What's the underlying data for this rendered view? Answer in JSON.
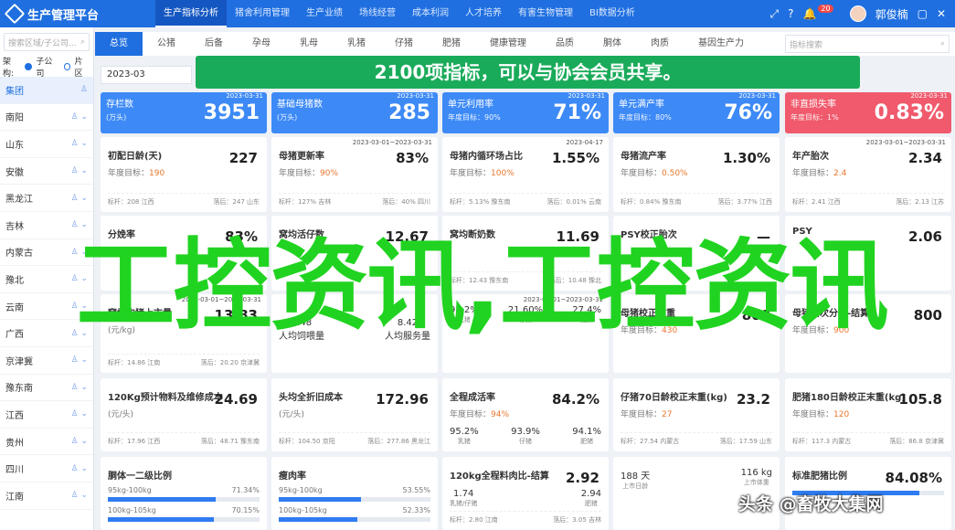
{
  "header": {
    "title": "生产管理平台",
    "nav": [
      "生产指标分析",
      "猪舍利用管理",
      "生产业绩",
      "场线经营",
      "成本利润",
      "人才培养",
      "有害生物管理",
      "BI数据分析"
    ],
    "badge": "20",
    "user": "郭俊楠"
  },
  "sidebar": {
    "search_placeholder": "搜索区域/子公司...",
    "filter_label": "架构:",
    "radio1": "子公司",
    "radio2": "片区",
    "items": [
      "集团",
      "南阳",
      "山东",
      "安徽",
      "黑龙江",
      "吉林",
      "内蒙古",
      "豫北",
      "云南",
      "广西",
      "京津冀",
      "豫东南",
      "江西",
      "贵州",
      "四川",
      "江南"
    ]
  },
  "tabs": {
    "items": [
      "总览",
      "公猪",
      "后备",
      "孕母",
      "乳母",
      "乳猪",
      "仔猪",
      "肥猪",
      "健康管理",
      "品质",
      "胴体",
      "肉质",
      "基因生产力"
    ],
    "search_placeholder": "指标搜索"
  },
  "date": "2023-03",
  "banner": "2100项指标，可以与协会会员共享。",
  "kpis": [
    {
      "label": "存栏数",
      "sub": "(万头)",
      "value": "3951",
      "date": "2023-03-31",
      "color": "#3d8af7"
    },
    {
      "label": "基础母猪数",
      "sub": "(万头)",
      "value": "285",
      "date": "2023-03-31",
      "color": "#3d8af7"
    },
    {
      "label": "单元利用率",
      "sub": "年度目标：90%",
      "value": "71%",
      "date": "2023-03-31",
      "color": "#3d8af7"
    },
    {
      "label": "单元满产率",
      "sub": "年度目标：80%",
      "value": "76%",
      "date": "2023-03-31",
      "color": "#3d8af7"
    },
    {
      "label": "非直损失率",
      "sub": "年度目标：1%",
      "value": "0.83%",
      "date": "2023-03-31",
      "color": "#f05a6c"
    }
  ],
  "row2": [
    {
      "title": "初配日龄(天)",
      "value": "227",
      "target": "190",
      "f1": "标杆：208 江西",
      "f2": "落后：247 山东",
      "date": ""
    },
    {
      "title": "母猪更新率",
      "value": "83%",
      "target": "90%",
      "f1": "标杆：127% 吉林",
      "f2": "落后：40% 四川",
      "date": "2023-03-01~2023-03-31"
    },
    {
      "title": "母猪内循环场占比",
      "value": "1.55%",
      "target": "100%",
      "f1": "标杆：5.13% 豫东南",
      "f2": "落后：0.01% 云南",
      "date": "2023-04-17"
    },
    {
      "title": "母猪流产率",
      "value": "1.30%",
      "target": "0.50%",
      "f1": "标杆：0.84% 豫东南",
      "f2": "落后：3.77% 江西",
      "date": ""
    },
    {
      "title": "年产胎次",
      "value": "2.34",
      "target": "2.4",
      "f1": "标杆：2.41 江西",
      "f2": "落后：2.13 江苏",
      "date": "2023-03-01~2023-03-31"
    }
  ],
  "row3": [
    {
      "title": "分娩率",
      "value": "83%"
    },
    {
      "title": "窝均活仔数",
      "value": "12.67"
    },
    {
      "title": "窝均断奶数",
      "value": "11.69",
      "f1": "标杆：12.43 豫东南",
      "f2": "落后：10.48 豫北"
    },
    {
      "title": "PSY校正胎次",
      "value": "—"
    },
    {
      "title": "PSY",
      "value": "2.06"
    }
  ],
  "row4": [
    {
      "title": "窝均肉猪上市量",
      "sub": "(元/kg)",
      "value": "13.83",
      "f1": "标杆：14.86 江南",
      "f2": "落后：20.20 京津冀",
      "date": "2023-03-01~2023-03-31"
    },
    {
      "label1": "人均饲喂量",
      "label2": "人均服务量",
      "v1": "8.48",
      "v2": "8.42"
    },
    {
      "date": "2023-03-01~2023-03-31",
      "v1": "92.2%",
      "v2": "21.60%",
      "v3": "27.4%",
      "l1": "乳猪",
      "l2": "仔猪",
      "l3": "肥猪",
      "s1": "18.4%"
    },
    {
      "title": "母猪校正末重",
      "target": "430",
      "value": "800"
    },
    {
      "title": "母猪胎次分布-结算",
      "target": "900",
      "value": "800"
    }
  ],
  "row5": [
    {
      "title": "120Kg预计物料及维修成本",
      "sub": "(元/头)",
      "value": "24.69",
      "f1": "标杆：17.96 江西",
      "f2": "落后：48.71 豫东南"
    },
    {
      "title": "头均全折旧成本",
      "sub": "(元/头)",
      "value": "172.96",
      "f1": "标杆：104.50 京阳",
      "f2": "落后：277.86 黑龙江"
    },
    {
      "title": "全程成活率",
      "value": "84.2%",
      "target": "94%",
      "v1": "95.2%",
      "v2": "93.9%",
      "v3": "94.1%",
      "l1": "乳猪",
      "l2": "仔猪",
      "l3": "肥猪"
    },
    {
      "title": "仔猪70日龄校正末重(kg)",
      "value": "23.2",
      "target": "27",
      "f1": "标杆：27.54 内蒙古",
      "f2": "落后：17.59 山东"
    },
    {
      "title": "肥猪180日龄校正末重(kg)",
      "value": "105.8",
      "target": "120",
      "f1": "标杆：117.3 内蒙古",
      "f2": "落后：86.8 京津冀"
    }
  ],
  "row6": [
    {
      "title": "胴体一二级比例",
      "a": "95kg-100kg",
      "ap": "71.34%",
      "b": "100kg-105kg",
      "bp": "70.15%",
      "fa": 0.71,
      "fb": 0.7
    },
    {
      "title": "瘦肉率",
      "a": "95kg-100kg",
      "ap": "53.55%",
      "b": "100kg-105kg",
      "bp": "52.33%",
      "fa": 0.54,
      "fb": 0.52
    },
    {
      "title": "120kg全程料肉比-结算",
      "value": "2.92",
      "f1": "标杆：2.80 江南",
      "f2": "落后：3.05 吉林",
      "v1": "1.74",
      "l1": "乳猪/仔猪",
      "v2": "2.94",
      "l2": "肥猪"
    },
    {
      "v1": "188 天",
      "v2": "116 kg",
      "l1": "上市日龄",
      "l2": "上市体重"
    },
    {
      "title": "标准肥猪比例",
      "value": "84.08%",
      "fa": 0.84
    }
  ],
  "watermark": "工控资讯,工控资讯",
  "credit": "头条 @畜牧大集网"
}
